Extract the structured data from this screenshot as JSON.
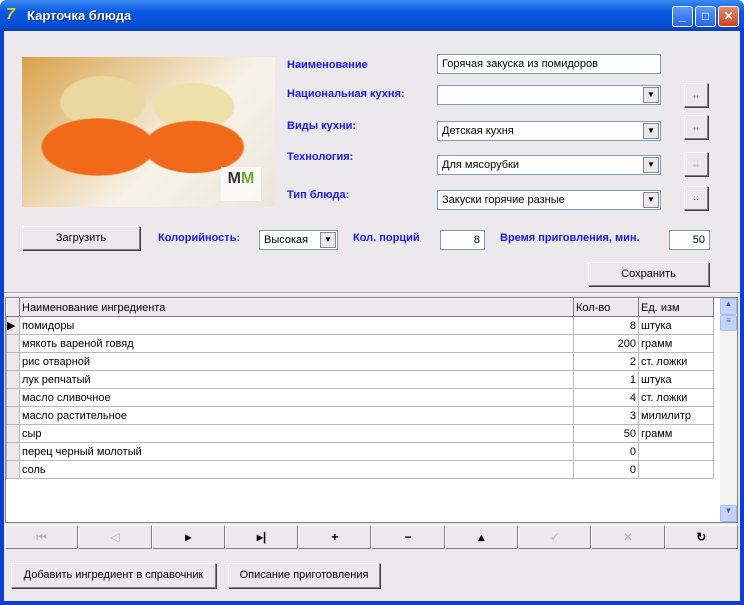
{
  "window": {
    "title": "Карточка блюда",
    "icon": "app-icon"
  },
  "form": {
    "name_label": "Наименование",
    "name_value": "Горячая закуска из помидоров",
    "national_label": "Национальная кухня:",
    "national_value": "",
    "kind_label": "Виды кухни:",
    "kind_value": "Детская кухня",
    "tech_label": "Технология:",
    "tech_value": "Для мясорубки",
    "type_label": "Тип блюда:",
    "type_value": "Закуски горячие разные",
    "ellipsis": "..",
    "load_label": "Загрузить",
    "calor_label": "Колорийность:",
    "calor_value": "Высокая",
    "portions_label": "Кол. порций",
    "portions_value": "8",
    "time_label": "Время приговления, мин.",
    "time_value": "50",
    "save_label": "Сохранить",
    "photo_logo": "MM"
  },
  "grid": {
    "headers": [
      "Наименование ингредиента",
      "Кол-во",
      "Ед. изм"
    ],
    "rows": [
      [
        "помидоры",
        "8",
        "штука"
      ],
      [
        "мякоть вареной говяд",
        "200",
        "грамм"
      ],
      [
        "рис отварной",
        "2",
        "ст. ложки"
      ],
      [
        "лук репчатый",
        "1",
        "штука"
      ],
      [
        "масло сливочное",
        "4",
        "ст. ложки"
      ],
      [
        "масло растительное",
        "3",
        "мили­литр"
      ],
      [
        "сыр",
        "50",
        "грамм"
      ],
      [
        "перец черный молотый",
        "0",
        ""
      ],
      [
        "соль",
        "0",
        ""
      ]
    ]
  },
  "navigator": [
    "first",
    "prior",
    "next",
    "last",
    "insert",
    "delete",
    "edit",
    "post",
    "cancel",
    "refresh"
  ],
  "bottom": {
    "add_label": "Добавить ингредиент в справочник",
    "desc_label": "Описание приготовления"
  }
}
